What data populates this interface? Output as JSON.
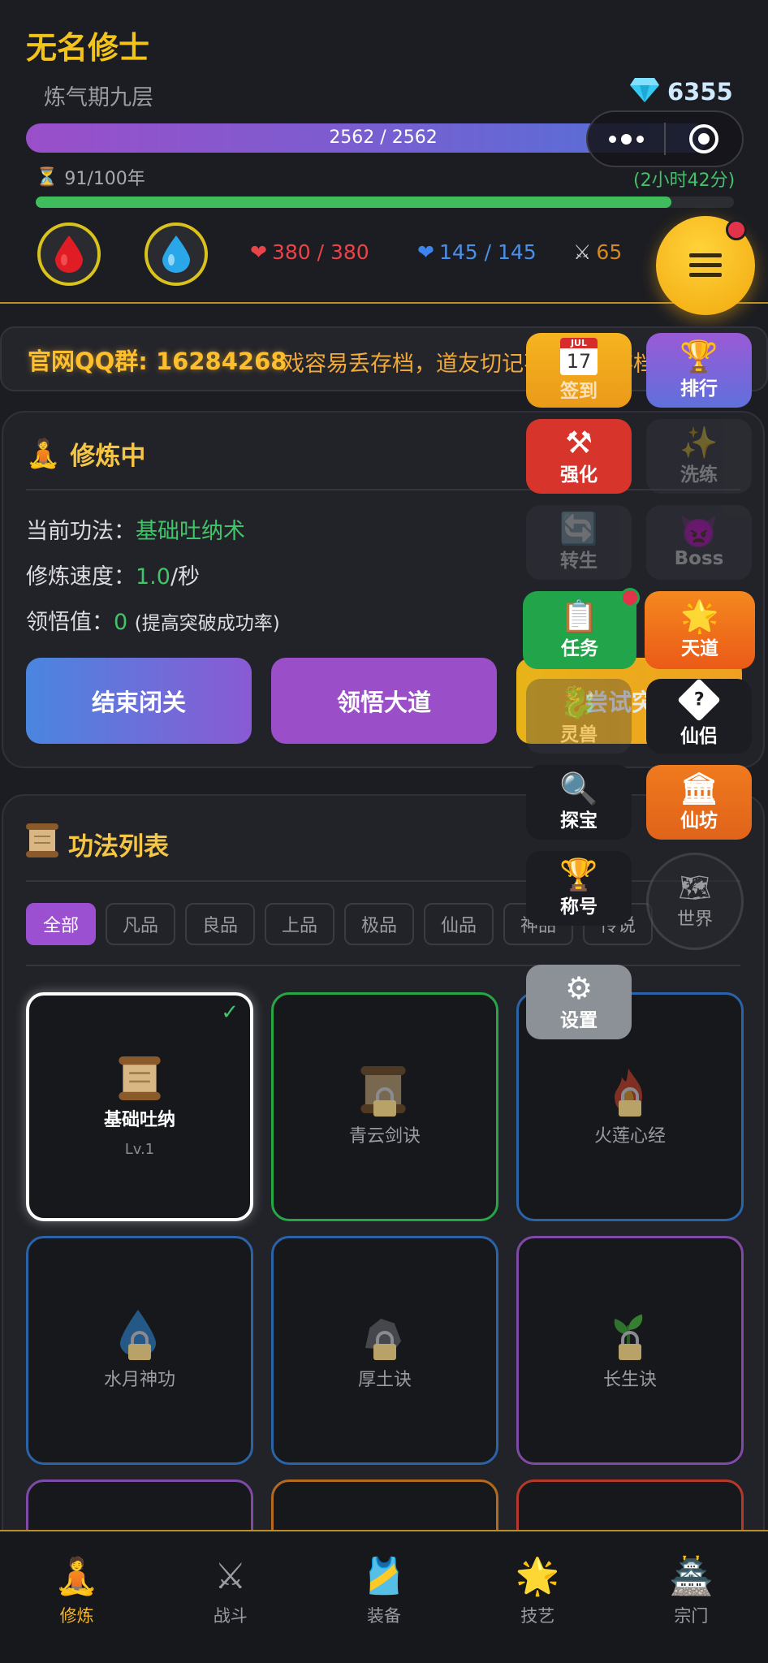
{
  "player": {
    "name": "无名修士",
    "realm": "炼气期九层",
    "gems": "6355",
    "xp_text": "2562 / 2562",
    "lifespan": "91/100年",
    "lifespan_fraction": 0.91,
    "lifespan_remaining": "(2小时42分)"
  },
  "stats": {
    "hp": "380 / 380",
    "mp": "145 / 145",
    "attack": "65"
  },
  "announcement": {
    "qq": "官网QQ群: 16284268",
    "message": "戏容易丢存档，道友切记不时导出存档"
  },
  "cultivation": {
    "title": "修炼中",
    "method_label": "当前功法：",
    "method_value": "基础吐纳术",
    "speed_label": "修炼速度：",
    "speed_value": "1.0",
    "speed_unit": "/秒",
    "insight_label": "领悟值：",
    "insight_value": "0",
    "insight_note": "(提高突破成功率)",
    "buttons": [
      "结束闭关",
      "领悟大道",
      "尝试突"
    ]
  },
  "techniques": {
    "title": "功法列表",
    "filters": [
      "全部",
      "凡品",
      "良品",
      "上品",
      "极品",
      "仙品",
      "神品",
      "传说"
    ],
    "cards": [
      {
        "name": "基础吐纳",
        "level": "Lv.1",
        "icon": "scroll",
        "locked": false,
        "border": "#ffffff",
        "check": "✓"
      },
      {
        "name": "青云剑诀",
        "icon": "scroll",
        "locked": true,
        "border": "#27a646"
      },
      {
        "name": "火莲心经",
        "icon": "fire",
        "locked": true,
        "border": "#2a63a6"
      },
      {
        "name": "水月神功",
        "icon": "water-drop",
        "locked": true,
        "border": "#2a63a6"
      },
      {
        "name": "厚土诀",
        "icon": "rock",
        "locked": true,
        "border": "#2a63a6"
      },
      {
        "name": "长生诀",
        "icon": "herb",
        "locked": true,
        "border": "#7f4aa6"
      }
    ],
    "partial_row_colors": [
      "#7f4aa6",
      "#b46a1c",
      "#b6382c"
    ]
  },
  "float_menu": {
    "tiles": [
      {
        "label": "签到",
        "icon": "calendar",
        "month": "JUL",
        "day": "17",
        "color": "#f0a91e"
      },
      {
        "label": "排行",
        "icon": "trophy",
        "color": "#7b63d8"
      },
      {
        "label": "强化",
        "icon": "hammer",
        "color": "#d7352c"
      },
      {
        "label": "洗练",
        "icon": "sparkles",
        "color": "#3b3c44"
      },
      {
        "label": "转生",
        "icon": "cycle",
        "color": "#3b3c44"
      },
      {
        "label": "Boss",
        "icon": "demon",
        "color": "#3b3c44"
      },
      {
        "label": "任务",
        "icon": "clipboard",
        "color": "#22a44a"
      },
      {
        "label": "天道",
        "icon": "star",
        "color": "#f06a1a"
      },
      {
        "label": "灵兽",
        "icon": "dragon",
        "color": "#3b3c44"
      },
      {
        "label": "仙侣",
        "icon": "question",
        "color": "#1c1d22"
      },
      {
        "label": "探宝",
        "icon": "magnifier",
        "color": "#1c1d22"
      },
      {
        "label": "仙坊",
        "icon": "temple",
        "color": "#e8741a"
      },
      {
        "label": "称号",
        "icon": "trophy",
        "color": "#1c1d22"
      },
      {
        "label": "世界",
        "icon": "map",
        "color": "#3b3c44"
      },
      {
        "label": "设置",
        "icon": "gear",
        "color": "#8c9198"
      }
    ]
  },
  "nav": {
    "items": [
      {
        "label": "修炼",
        "icon": "meditating-person"
      },
      {
        "label": "战斗",
        "icon": "crossed-swords"
      },
      {
        "label": "装备",
        "icon": "armor-vest"
      },
      {
        "label": "技艺",
        "icon": "glowing-star"
      },
      {
        "label": "宗门",
        "icon": "temple-building"
      }
    ]
  }
}
